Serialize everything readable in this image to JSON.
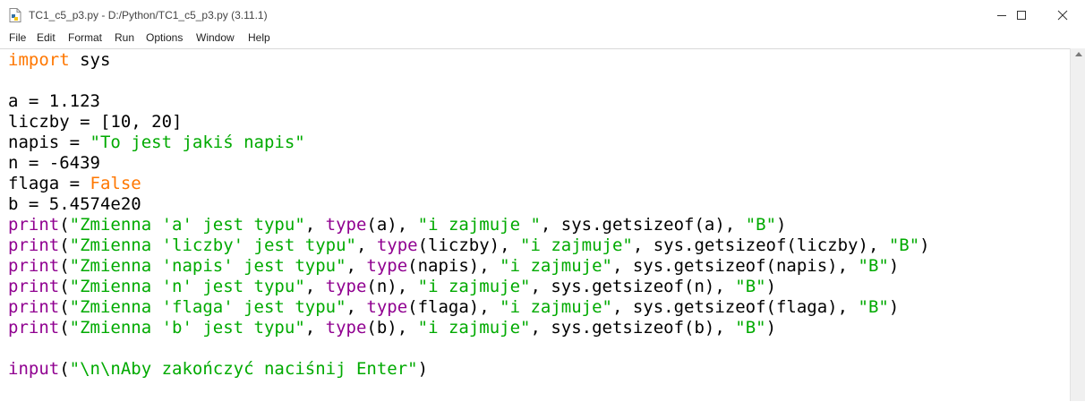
{
  "window": {
    "title": "TC1_c5_p3.py - D:/Python/TC1_c5_p3.py (3.11.1)",
    "controls": {
      "minimize": "—",
      "maximize": "☐",
      "close": "✕"
    }
  },
  "menu": [
    "File",
    "Edit",
    "Format",
    "Run",
    "Options",
    "Window",
    "Help"
  ],
  "colors": {
    "keyword": "#ff7700",
    "builtin": "#900090",
    "string": "#00aa00",
    "default": "#000000"
  },
  "code_lines": [
    [
      {
        "t": "import",
        "c": "kw"
      },
      {
        "t": " sys"
      }
    ],
    [],
    [
      {
        "t": "a = 1.123"
      }
    ],
    [
      {
        "t": "liczby = [10, 20]"
      }
    ],
    [
      {
        "t": "napis = "
      },
      {
        "t": "\"To jest jakiś napis\"",
        "c": "st"
      }
    ],
    [
      {
        "t": "n = -6439"
      }
    ],
    [
      {
        "t": "flaga = "
      },
      {
        "t": "False",
        "c": "kw"
      }
    ],
    [
      {
        "t": "b = 5.4574e20"
      }
    ],
    [
      {
        "t": "print",
        "c": "bi"
      },
      {
        "t": "("
      },
      {
        "t": "\"Zmienna 'a' jest typu\"",
        "c": "st"
      },
      {
        "t": ", "
      },
      {
        "t": "type",
        "c": "bi"
      },
      {
        "t": "(a), "
      },
      {
        "t": "\"i zajmuje \"",
        "c": "st"
      },
      {
        "t": ", sys.getsizeof(a), "
      },
      {
        "t": "\"B\"",
        "c": "st"
      },
      {
        "t": ")"
      }
    ],
    [
      {
        "t": "print",
        "c": "bi"
      },
      {
        "t": "("
      },
      {
        "t": "\"Zmienna 'liczby' jest typu\"",
        "c": "st"
      },
      {
        "t": ", "
      },
      {
        "t": "type",
        "c": "bi"
      },
      {
        "t": "(liczby), "
      },
      {
        "t": "\"i zajmuje\"",
        "c": "st"
      },
      {
        "t": ", sys.getsizeof(liczby), "
      },
      {
        "t": "\"B\"",
        "c": "st"
      },
      {
        "t": ")"
      }
    ],
    [
      {
        "t": "print",
        "c": "bi"
      },
      {
        "t": "("
      },
      {
        "t": "\"Zmienna 'napis' jest typu\"",
        "c": "st"
      },
      {
        "t": ", "
      },
      {
        "t": "type",
        "c": "bi"
      },
      {
        "t": "(napis), "
      },
      {
        "t": "\"i zajmuje\"",
        "c": "st"
      },
      {
        "t": ", sys.getsizeof(napis), "
      },
      {
        "t": "\"B\"",
        "c": "st"
      },
      {
        "t": ")"
      }
    ],
    [
      {
        "t": "print",
        "c": "bi"
      },
      {
        "t": "("
      },
      {
        "t": "\"Zmienna 'n' jest typu\"",
        "c": "st"
      },
      {
        "t": ", "
      },
      {
        "t": "type",
        "c": "bi"
      },
      {
        "t": "(n), "
      },
      {
        "t": "\"i zajmuje\"",
        "c": "st"
      },
      {
        "t": ", sys.getsizeof(n), "
      },
      {
        "t": "\"B\"",
        "c": "st"
      },
      {
        "t": ")"
      }
    ],
    [
      {
        "t": "print",
        "c": "bi"
      },
      {
        "t": "("
      },
      {
        "t": "\"Zmienna 'flaga' jest typu\"",
        "c": "st"
      },
      {
        "t": ", "
      },
      {
        "t": "type",
        "c": "bi"
      },
      {
        "t": "(flaga), "
      },
      {
        "t": "\"i zajmuje\"",
        "c": "st"
      },
      {
        "t": ", sys.getsizeof(flaga), "
      },
      {
        "t": "\"B\"",
        "c": "st"
      },
      {
        "t": ")"
      }
    ],
    [
      {
        "t": "print",
        "c": "bi"
      },
      {
        "t": "("
      },
      {
        "t": "\"Zmienna 'b' jest typu\"",
        "c": "st"
      },
      {
        "t": ", "
      },
      {
        "t": "type",
        "c": "bi"
      },
      {
        "t": "(b), "
      },
      {
        "t": "\"i zajmuje\"",
        "c": "st"
      },
      {
        "t": ", sys.getsizeof(b), "
      },
      {
        "t": "\"B\"",
        "c": "st"
      },
      {
        "t": ")"
      }
    ],
    [],
    [
      {
        "t": "input",
        "c": "bi"
      },
      {
        "t": "("
      },
      {
        "t": "\"\\n\\nAby zakończyć naciśnij Enter\"",
        "c": "st"
      },
      {
        "t": ")"
      }
    ]
  ]
}
